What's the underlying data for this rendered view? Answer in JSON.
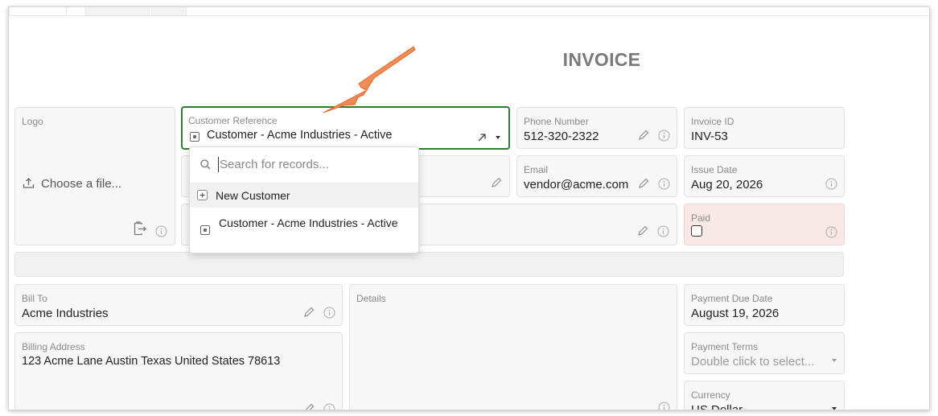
{
  "invoice": {
    "title": "INVOICE"
  },
  "logo": {
    "label": "Logo",
    "choose_file": "Choose a file..."
  },
  "customer_reference": {
    "label": "Customer Reference",
    "value": "Customer - Acme Industries - Active"
  },
  "phone": {
    "label": "Phone Number",
    "value": "512-320-2322"
  },
  "invoice_id": {
    "label": "Invoice ID",
    "value": "INV-53"
  },
  "email": {
    "label": "Email",
    "value": "vendor@acme.com"
  },
  "issue_date": {
    "label": "Issue Date",
    "value": "Aug 20, 2026"
  },
  "paid": {
    "label": "Paid",
    "checked": false
  },
  "dropdown": {
    "search_placeholder": "Search for records...",
    "new_label": "New Customer",
    "items": [
      {
        "label": "Customer - Acme Industries - Active"
      }
    ]
  },
  "bill_to": {
    "label": "Bill To",
    "value": "Acme Industries"
  },
  "details": {
    "label": "Details"
  },
  "billing_address": {
    "label": "Billing Address",
    "value": "123 Acme Lane  Austin Texas United States 78613"
  },
  "payment_due_date": {
    "label": "Payment Due Date",
    "value": "August 19, 2026"
  },
  "payment_terms": {
    "label": "Payment Terms",
    "placeholder": "Double click to select..."
  },
  "currency": {
    "label": "Currency",
    "value": "US Dollar"
  },
  "colors": {
    "focus": "#2e7d32",
    "arrow": "#ee7a3a",
    "paid_bg": "#f8e8e8"
  }
}
